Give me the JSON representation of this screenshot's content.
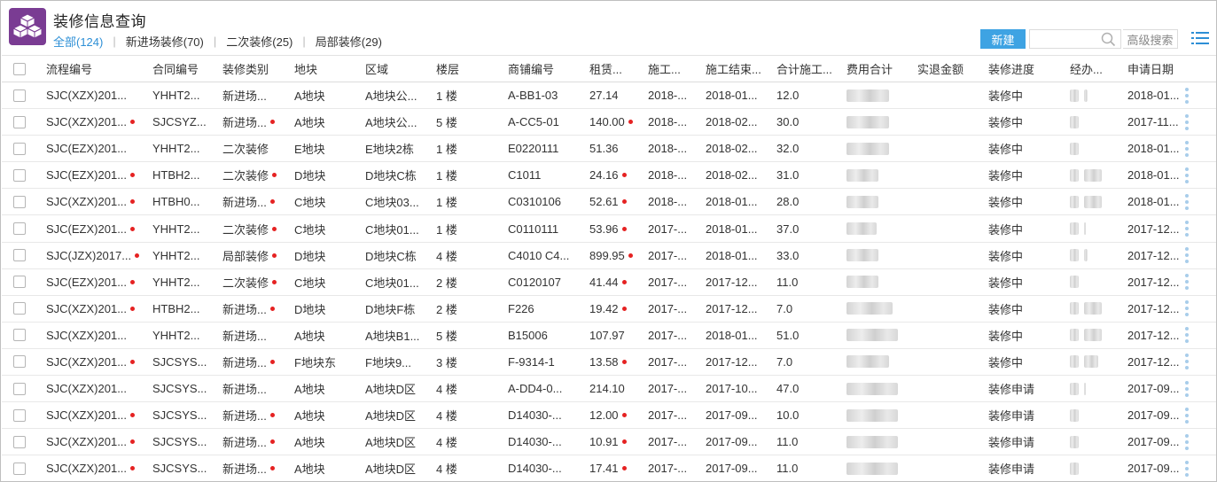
{
  "header": {
    "title": "装修信息查询",
    "tabs": [
      {
        "label": "全部(124)",
        "active": true
      },
      {
        "label": "新进场装修(70)",
        "active": false
      },
      {
        "label": "二次装修(25)",
        "active": false
      },
      {
        "label": "局部装修(29)",
        "active": false
      }
    ],
    "tab_separator": "|"
  },
  "toolbar": {
    "new_label": "新建",
    "search_placeholder": "",
    "advanced_search_label": "高级搜索"
  },
  "colors": {
    "accent": "#3ea3e3",
    "active_tab": "#2d8fd6",
    "logo_bg": "#7a3c93",
    "dot": "#e52222"
  },
  "table": {
    "columns": [
      "流程编号",
      "合同编号",
      "装修类别",
      "地块",
      "区域",
      "楼层",
      "商铺编号",
      "租赁...",
      "施工...",
      "施工结束...",
      "合计施工...",
      "费用合计",
      "实退金额",
      "装修进度",
      "经办...",
      "申请日期"
    ],
    "rows": [
      {
        "flow": "SJC(XZX)201...",
        "flow_dot": false,
        "contract": "YHHT2...",
        "contract_dot": false,
        "type": "新进场...",
        "type_dot": false,
        "block": "A地块",
        "block_dot": false,
        "area": "A地块公...",
        "floor": "1 楼",
        "shop": "A-BB1-03",
        "rent": "27.14",
        "rent_dot": false,
        "start": "2018-...",
        "end": "2018-01...",
        "days": "12.0",
        "progress": "装修中",
        "date": "2018-01..."
      },
      {
        "flow": "SJC(XZX)201...",
        "flow_dot": true,
        "contract": "SJCSYZ...",
        "contract_dot": false,
        "type": "新进场...",
        "type_dot": true,
        "block": "A地块",
        "block_dot": false,
        "area": "A地块公...",
        "floor": "5 楼",
        "shop": "A-CC5-01",
        "rent": "140.00",
        "rent_dot": true,
        "start": "2018-...",
        "end": "2018-02...",
        "days": "30.0",
        "progress": "装修中",
        "date": "2017-11..."
      },
      {
        "flow": "SJC(EZX)201...",
        "flow_dot": false,
        "contract": "YHHT2...",
        "contract_dot": false,
        "type": "二次装修",
        "type_dot": false,
        "block": "E地块",
        "block_dot": false,
        "area": "E地块2栋",
        "floor": "1 楼",
        "shop": "E0220111",
        "rent": "51.36",
        "rent_dot": false,
        "start": "2018-...",
        "end": "2018-02...",
        "days": "32.0",
        "progress": "装修中",
        "date": "2018-01..."
      },
      {
        "flow": "SJC(EZX)201...",
        "flow_dot": true,
        "contract": "HTBH2...",
        "contract_dot": false,
        "type": "二次装修",
        "type_dot": true,
        "block": "D地块",
        "block_dot": false,
        "area": "D地块C栋",
        "floor": "1 楼",
        "shop": "C1011",
        "rent": "24.16",
        "rent_dot": true,
        "start": "2018-...",
        "end": "2018-02...",
        "days": "31.0",
        "progress": "装修中",
        "date": "2018-01..."
      },
      {
        "flow": "SJC(XZX)201...",
        "flow_dot": true,
        "contract": "HTBH0...",
        "contract_dot": false,
        "type": "新进场...",
        "type_dot": true,
        "block": "C地块",
        "block_dot": false,
        "area": "C地块03...",
        "floor": "1 楼",
        "shop": "C0310106",
        "rent": "52.61",
        "rent_dot": true,
        "start": "2018-...",
        "end": "2018-01...",
        "days": "28.0",
        "progress": "装修中",
        "date": "2018-01..."
      },
      {
        "flow": "SJC(EZX)201...",
        "flow_dot": true,
        "contract": "YHHT2...",
        "contract_dot": false,
        "type": "二次装修",
        "type_dot": true,
        "block": "C地块",
        "block_dot": false,
        "area": "C地块01...",
        "floor": "1 楼",
        "shop": "C0110111",
        "rent": "53.96",
        "rent_dot": true,
        "start": "2017-...",
        "end": "2018-01...",
        "days": "37.0",
        "progress": "装修中",
        "date": "2017-12..."
      },
      {
        "flow": "SJC(JZX)2017...",
        "flow_dot": true,
        "contract": "YHHT2...",
        "contract_dot": false,
        "type": "局部装修",
        "type_dot": true,
        "block": "D地块",
        "block_dot": false,
        "area": "D地块C栋",
        "floor": "4 楼",
        "shop": "C4010 C4...",
        "rent": "899.95",
        "rent_dot": true,
        "start": "2017-...",
        "end": "2018-01...",
        "days": "33.0",
        "progress": "装修中",
        "date": "2017-12..."
      },
      {
        "flow": "SJC(EZX)201...",
        "flow_dot": true,
        "contract": "YHHT2...",
        "contract_dot": false,
        "type": "二次装修",
        "type_dot": true,
        "block": "C地块",
        "block_dot": false,
        "area": "C地块01...",
        "floor": "2 楼",
        "shop": "C0120107",
        "rent": "41.44",
        "rent_dot": true,
        "start": "2017-...",
        "end": "2017-12...",
        "days": "11.0",
        "progress": "装修中",
        "date": "2017-12..."
      },
      {
        "flow": "SJC(XZX)201...",
        "flow_dot": true,
        "contract": "HTBH2...",
        "contract_dot": false,
        "type": "新进场...",
        "type_dot": true,
        "block": "D地块",
        "block_dot": false,
        "area": "D地块F栋",
        "floor": "2 楼",
        "shop": "F226",
        "rent": "19.42",
        "rent_dot": true,
        "start": "2017-...",
        "end": "2017-12...",
        "days": "7.0",
        "progress": "装修中",
        "date": "2017-12..."
      },
      {
        "flow": "SJC(XZX)201...",
        "flow_dot": false,
        "contract": "YHHT2...",
        "contract_dot": false,
        "type": "新进场...",
        "type_dot": false,
        "block": "A地块",
        "block_dot": false,
        "area": "A地块B1...",
        "floor": "5 楼",
        "shop": "B15006",
        "rent": "107.97",
        "rent_dot": false,
        "start": "2017-...",
        "end": "2018-01...",
        "days": "51.0",
        "progress": "装修中",
        "date": "2017-12..."
      },
      {
        "flow": "SJC(XZX)201...",
        "flow_dot": true,
        "contract": "SJCSYS...",
        "contract_dot": false,
        "type": "新进场...",
        "type_dot": true,
        "block": "F地块东",
        "block_dot": false,
        "area": "F地块9...",
        "floor": "3 楼",
        "shop": "F-9314-1",
        "rent": "13.58",
        "rent_dot": true,
        "start": "2017-...",
        "end": "2017-12...",
        "days": "7.0",
        "progress": "装修中",
        "date": "2017-12..."
      },
      {
        "flow": "SJC(XZX)201...",
        "flow_dot": false,
        "contract": "SJCSYS...",
        "contract_dot": false,
        "type": "新进场...",
        "type_dot": false,
        "block": "A地块",
        "block_dot": false,
        "area": "A地块D区",
        "floor": "4 楼",
        "shop": "A-DD4-0...",
        "rent": "214.10",
        "rent_dot": false,
        "start": "2017-...",
        "end": "2017-10...",
        "days": "47.0",
        "progress": "装修申请",
        "date": "2017-09..."
      },
      {
        "flow": "SJC(XZX)201...",
        "flow_dot": true,
        "contract": "SJCSYS...",
        "contract_dot": false,
        "type": "新进场...",
        "type_dot": true,
        "block": "A地块",
        "block_dot": false,
        "area": "A地块D区",
        "floor": "4 楼",
        "shop": "D14030-...",
        "rent": "12.00",
        "rent_dot": true,
        "start": "2017-...",
        "end": "2017-09...",
        "days": "10.0",
        "progress": "装修申请",
        "date": "2017-09..."
      },
      {
        "flow": "SJC(XZX)201...",
        "flow_dot": true,
        "contract": "SJCSYS...",
        "contract_dot": false,
        "type": "新进场...",
        "type_dot": true,
        "block": "A地块",
        "block_dot": false,
        "area": "A地块D区",
        "floor": "4 楼",
        "shop": "D14030-...",
        "rent": "10.91",
        "rent_dot": true,
        "start": "2017-...",
        "end": "2017-09...",
        "days": "11.0",
        "progress": "装修申请",
        "date": "2017-09..."
      },
      {
        "flow": "SJC(XZX)201...",
        "flow_dot": true,
        "contract": "SJCSYS...",
        "contract_dot": false,
        "type": "新进场...",
        "type_dot": true,
        "block": "A地块",
        "block_dot": false,
        "area": "A地块D区",
        "floor": "4 楼",
        "shop": "D14030-...",
        "rent": "17.41",
        "rent_dot": true,
        "start": "2017-...",
        "end": "2017-09...",
        "days": "11.0",
        "progress": "装修申请",
        "date": "2017-09..."
      }
    ]
  }
}
